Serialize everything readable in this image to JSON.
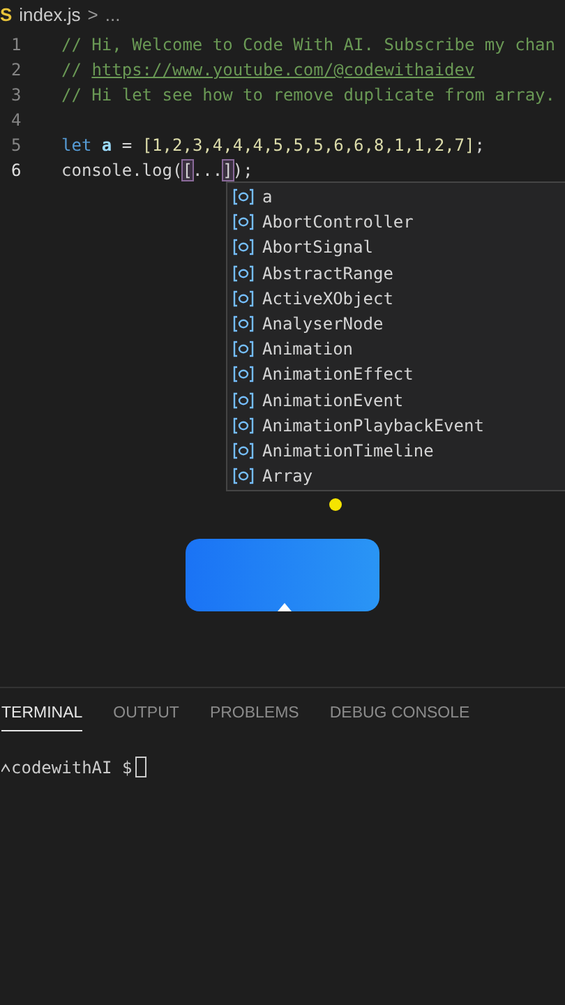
{
  "breadcrumb": {
    "file_icon": "S",
    "file": "index.js",
    "separator": ">",
    "more": "..."
  },
  "code_lines": [
    {
      "number": "1",
      "active": false,
      "tokens": [
        {
          "kind": "comment",
          "text": "// Hi, Welcome to Code With AI. Subscribe my chan"
        }
      ]
    },
    {
      "number": "2",
      "active": false,
      "tokens": [
        {
          "kind": "comment",
          "text": "// "
        },
        {
          "kind": "link",
          "text": "https://www.youtube.com/@codewithaidev"
        }
      ]
    },
    {
      "number": "3",
      "active": false,
      "tokens": [
        {
          "kind": "comment",
          "text": "// Hi let see how to remove duplicate from array."
        }
      ]
    },
    {
      "number": "4",
      "active": false
    },
    {
      "number": "5",
      "active": false,
      "tokens": [
        {
          "kind": "keyword",
          "text": "let "
        },
        {
          "kind": "variable",
          "text": "a"
        },
        {
          "kind": "plain",
          "text": " = "
        },
        {
          "kind": "bracket",
          "text": "[1,2,3,4,4,4,5,5,5,6,6,8,1,1,2,7]"
        },
        {
          "kind": "plain",
          "text": ";"
        }
      ]
    },
    {
      "number": "6",
      "active": true,
      "tokens": [
        {
          "kind": "plain",
          "text": "console.log("
        },
        {
          "kind": "match",
          "text": "["
        },
        {
          "kind": "plain",
          "text": "..."
        },
        {
          "kind": "match",
          "text": "]"
        },
        {
          "kind": "plain",
          "text": ");"
        }
      ]
    }
  ],
  "suggestions": [
    {
      "label": "a",
      "selected": false
    },
    {
      "label": "AbortController",
      "selected": false
    },
    {
      "label": "AbortSignal",
      "selected": false
    },
    {
      "label": "AbstractRange",
      "selected": false
    },
    {
      "label": "ActiveXObject",
      "selected": false
    },
    {
      "label": "AnalyserNode",
      "selected": false
    },
    {
      "label": "Animation",
      "selected": false
    },
    {
      "label": "AnimationEffect",
      "selected": false
    },
    {
      "label": "AnimationEvent",
      "selected": false
    },
    {
      "label": "AnimationPlaybackEvent",
      "selected": false
    },
    {
      "label": "AnimationTimeline",
      "selected": false
    },
    {
      "label": "Array",
      "selected": false
    }
  ],
  "panel_tabs": [
    {
      "label": "TERMINAL",
      "selected": true
    },
    {
      "label": "OUTPUT",
      "selected": false
    },
    {
      "label": "PROBLEMS",
      "selected": false
    },
    {
      "label": "DEBUG CONSOLE",
      "selected": false
    }
  ],
  "terminal": {
    "prompt": "codewithAI $"
  }
}
